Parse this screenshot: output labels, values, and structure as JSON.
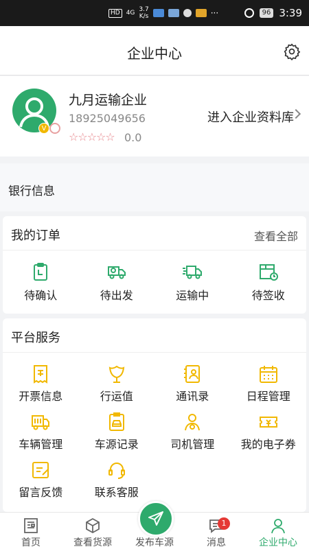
{
  "status_bar": {
    "hd": "HD",
    "net": "4G",
    "speed": "3.7",
    "speed_unit": "K/s",
    "more": "···",
    "battery": "96",
    "time": "3:39"
  },
  "header": {
    "title": "企业中心",
    "settings_icon": "gear-icon"
  },
  "profile": {
    "company_name": "九月运输企业",
    "phone": "18925049656",
    "stars": "☆☆☆☆☆",
    "score": "0.0",
    "badge_v": "V",
    "enter_library": "进入企业资料库"
  },
  "bank": {
    "label": "银行信息"
  },
  "orders": {
    "title": "我的订单",
    "view_all": "查看全部",
    "items": [
      {
        "label": "待确认",
        "icon": "clipboard-icon"
      },
      {
        "label": "待出发",
        "icon": "truck-clock-icon"
      },
      {
        "label": "运输中",
        "icon": "moving-truck-icon"
      },
      {
        "label": "待签收",
        "icon": "box-clock-icon"
      }
    ]
  },
  "services": {
    "title": "平台服务",
    "items": [
      {
        "label": "开票信息",
        "icon": "invoice-icon"
      },
      {
        "label": "行运值",
        "icon": "leaf-icon"
      },
      {
        "label": "通讯录",
        "icon": "contacts-icon"
      },
      {
        "label": "日程管理",
        "icon": "calendar-icon"
      },
      {
        "label": "车辆管理",
        "icon": "truck-icon"
      },
      {
        "label": "车源记录",
        "icon": "car-record-icon"
      },
      {
        "label": "司机管理",
        "icon": "driver-icon"
      },
      {
        "label": "我的电子券",
        "icon": "coupon-icon"
      },
      {
        "label": "留言反馈",
        "icon": "feedback-icon"
      },
      {
        "label": "联系客服",
        "icon": "headset-icon"
      }
    ]
  },
  "bottom_nav": {
    "items": [
      {
        "label": "首页",
        "icon": "newspaper-icon"
      },
      {
        "label": "查看货源",
        "icon": "cube-icon"
      },
      {
        "label": "发布车源",
        "icon": "send-icon"
      },
      {
        "label": "消息",
        "icon": "message-icon"
      },
      {
        "label": "企业中心",
        "icon": "user-icon"
      }
    ],
    "message_badge": "1",
    "active": "企业中心"
  },
  "colors": {
    "accent": "#2eaa6c",
    "service_icon": "#f1b800",
    "star": "#e67f86",
    "badge": "#e53935"
  }
}
